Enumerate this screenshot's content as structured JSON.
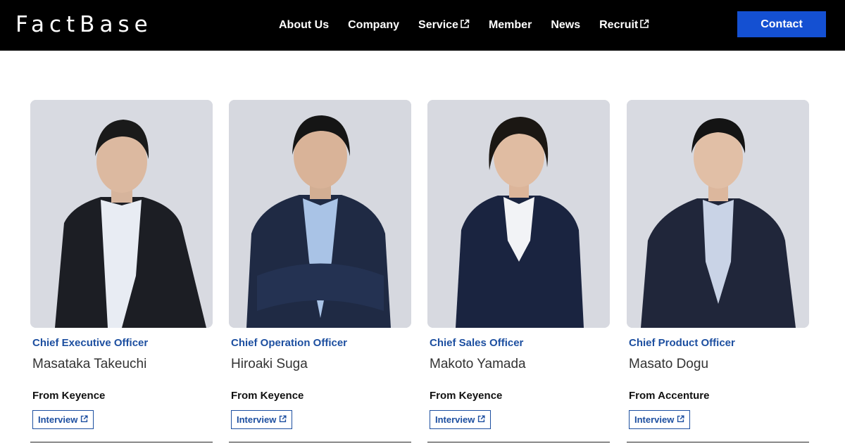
{
  "header": {
    "logo": "FactBase",
    "nav": [
      {
        "label": "About Us",
        "external": false
      },
      {
        "label": "Company",
        "external": false
      },
      {
        "label": "Service",
        "external": true
      },
      {
        "label": "Member",
        "external": false
      },
      {
        "label": "News",
        "external": false
      },
      {
        "label": "Recruit",
        "external": true
      }
    ],
    "contact_label": "Contact"
  },
  "members": [
    {
      "title": "Chief Executive Officer",
      "name": "Masataka Takeuchi",
      "from": "From Keyence",
      "interview_label": "Interview"
    },
    {
      "title": "Chief Operation Officer",
      "name": "Hiroaki Suga",
      "from": "From Keyence",
      "interview_label": "Interview"
    },
    {
      "title": "Chief Sales Officer",
      "name": "Makoto Yamada",
      "from": "From Keyence",
      "interview_label": "Interview"
    },
    {
      "title": "Chief Product Officer",
      "name": "Masato Dogu",
      "from": "From Accenture",
      "interview_label": "Interview"
    }
  ],
  "colors": {
    "header_bg": "#000000",
    "contact_bg": "#1450d2",
    "accent_blue": "#1d4fa0",
    "photo_bg": "#d9dbe2"
  },
  "icons": {
    "external_link": "external-link-icon"
  }
}
